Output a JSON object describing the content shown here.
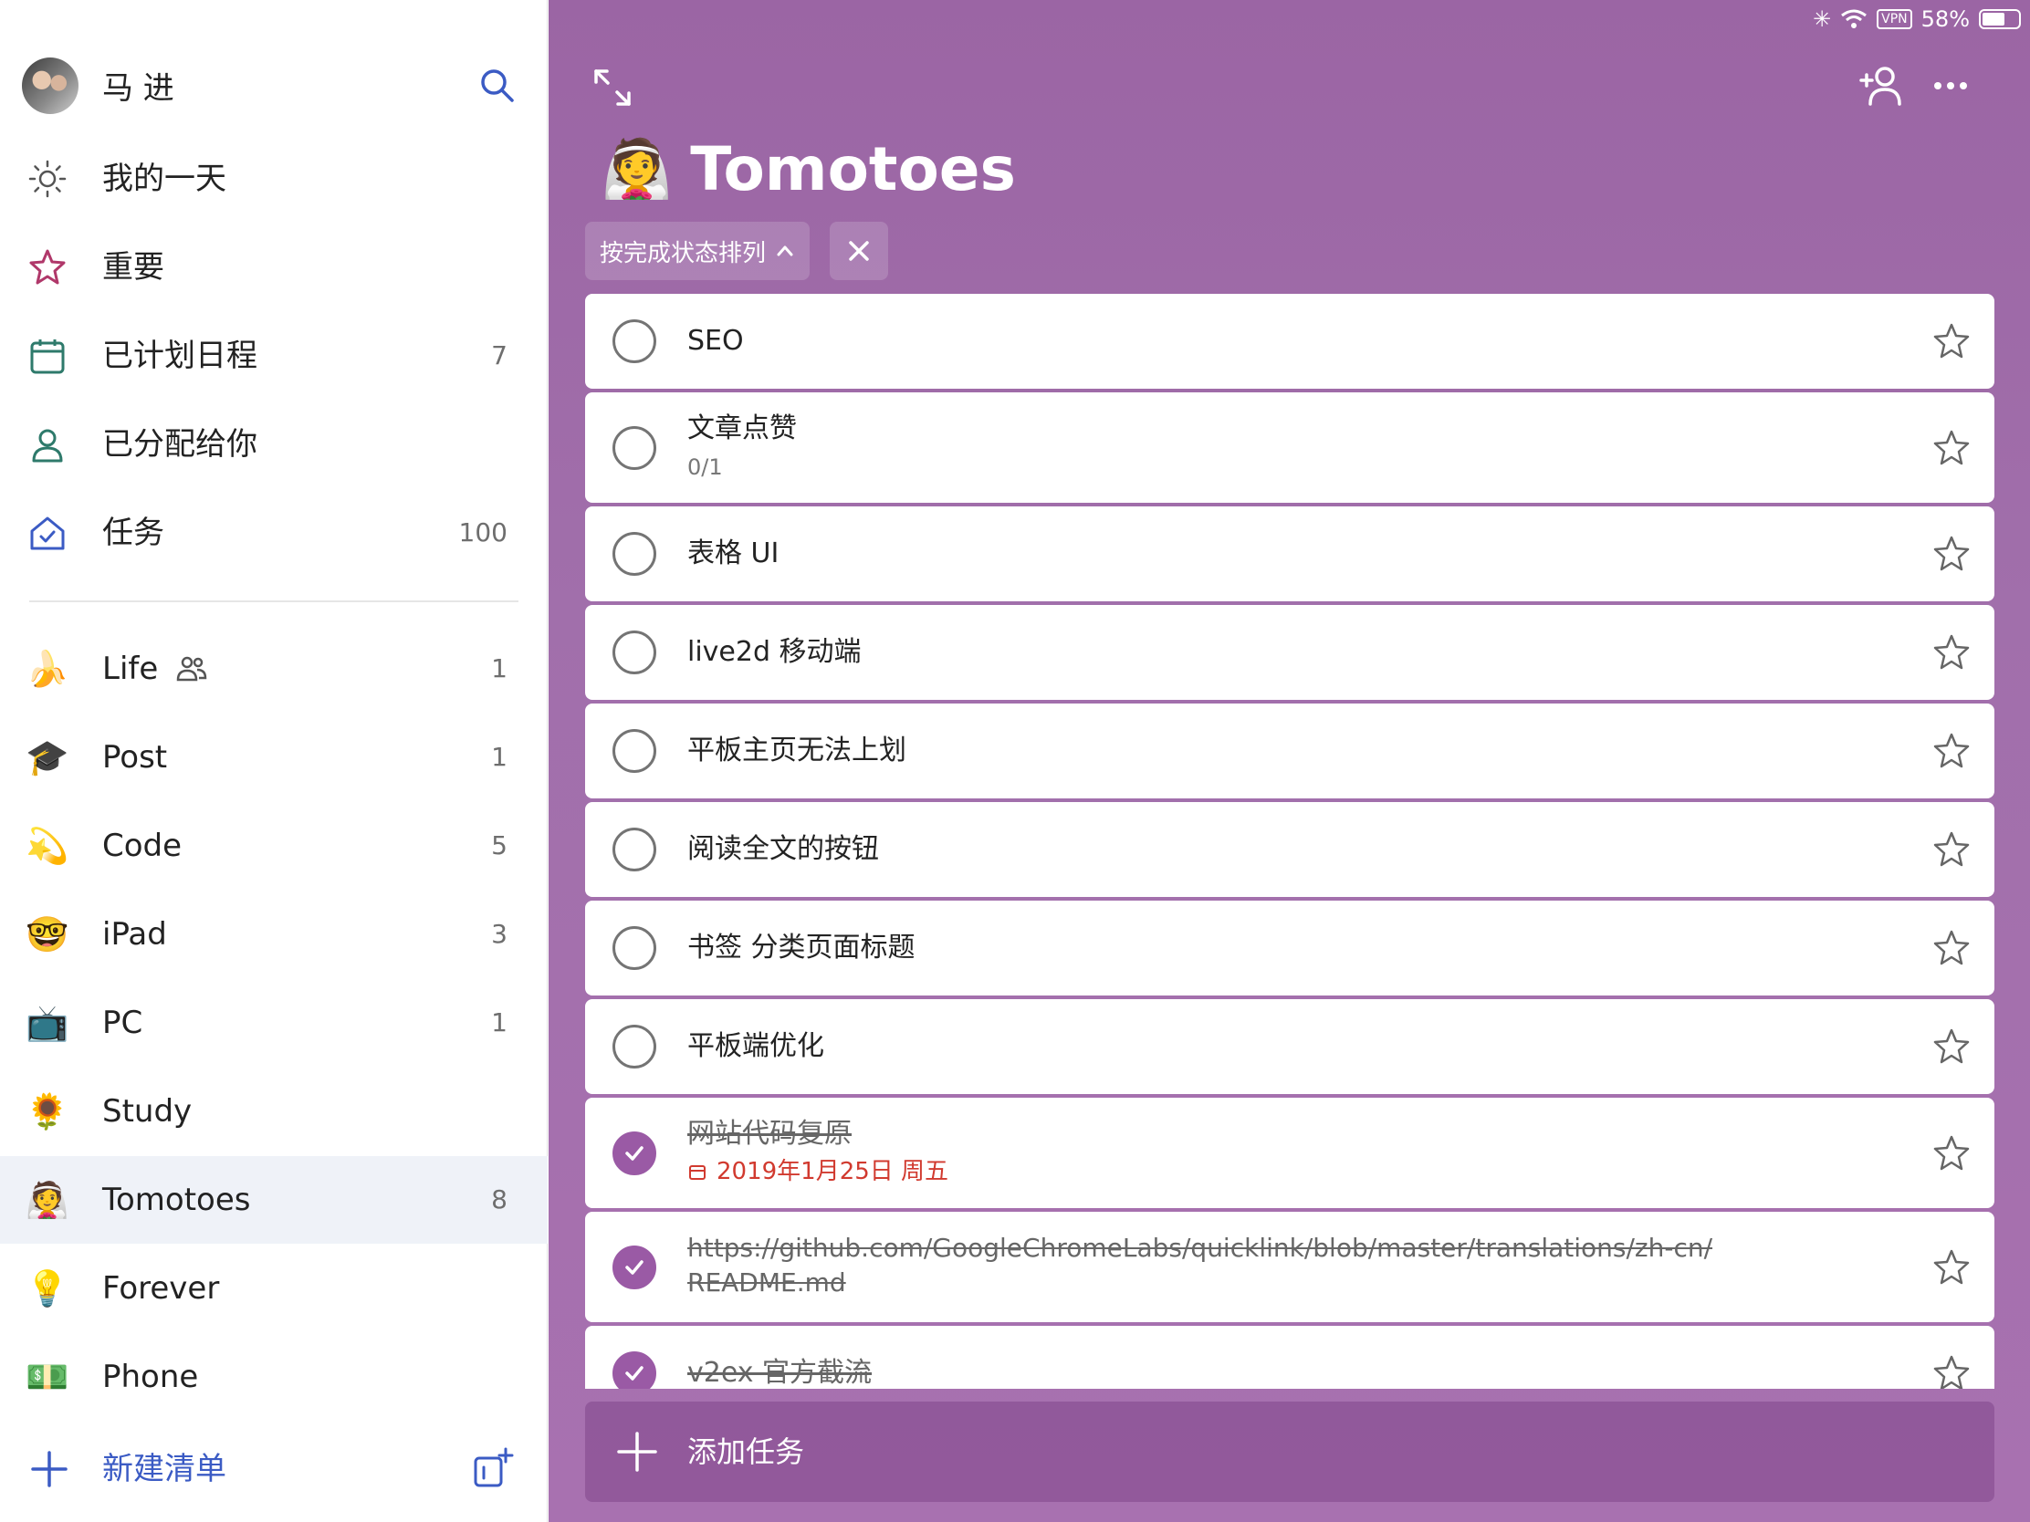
{
  "user": {
    "name": "马 进"
  },
  "nav": [
    {
      "label": "我的一天",
      "count": "",
      "icon": "sun-icon"
    },
    {
      "label": "重要",
      "count": "",
      "icon": "star-icon"
    },
    {
      "label": "已计划日程",
      "count": "7",
      "icon": "calendar-icon"
    },
    {
      "label": "已分配给你",
      "count": "",
      "icon": "person-icon"
    },
    {
      "label": "任务",
      "count": "100",
      "icon": "home-check-icon"
    }
  ],
  "lists": [
    {
      "emoji": "🍌",
      "label": "Life",
      "count": "1",
      "shared": true
    },
    {
      "emoji": "🎓",
      "label": "Post",
      "count": "1"
    },
    {
      "emoji": "💫",
      "label": "Code",
      "count": "5"
    },
    {
      "emoji": "🤓",
      "label": "iPad",
      "count": "3"
    },
    {
      "emoji": "📺",
      "label": "PC",
      "count": "1"
    },
    {
      "emoji": "🌻",
      "label": "Study",
      "count": ""
    },
    {
      "emoji": "👰",
      "label": "Tomotoes",
      "count": "8"
    },
    {
      "emoji": "💡",
      "label": "Forever",
      "count": ""
    },
    {
      "emoji": "💵",
      "label": "Phone",
      "count": ""
    }
  ],
  "new_list_label": "新建清单",
  "status": {
    "battery": "58%",
    "vpn": "VPN"
  },
  "main": {
    "emoji": "👰",
    "title": "Tomotoes",
    "sort_label": "按完成状态排列",
    "add_task_label": "添加任务"
  },
  "tasks": [
    {
      "title": "SEO",
      "done": false
    },
    {
      "title": "文章点赞",
      "sub": "0/1",
      "done": false
    },
    {
      "title": "表格 UI",
      "done": false
    },
    {
      "title": "live2d 移动端",
      "done": false
    },
    {
      "title": "平板主页无法上划",
      "done": false
    },
    {
      "title": "阅读全文的按钮",
      "done": false
    },
    {
      "title": "书签 分类页面标题",
      "done": false
    },
    {
      "title": "平板端优化",
      "done": false
    },
    {
      "title": "网站代码复原",
      "due": "2019年1月25日 周五",
      "done": true
    },
    {
      "title": "https://github.com/GoogleChromeLabs/quicklink/blob/master/translations/zh-cn/",
      "title2": "README.md",
      "done": true
    },
    {
      "title": "v2ex 官方截流",
      "done": true
    }
  ],
  "colors": {
    "accent_purple": "#9a5aa5",
    "new_list_blue": "#3b5bc4",
    "due_red": "#d13a2f"
  }
}
